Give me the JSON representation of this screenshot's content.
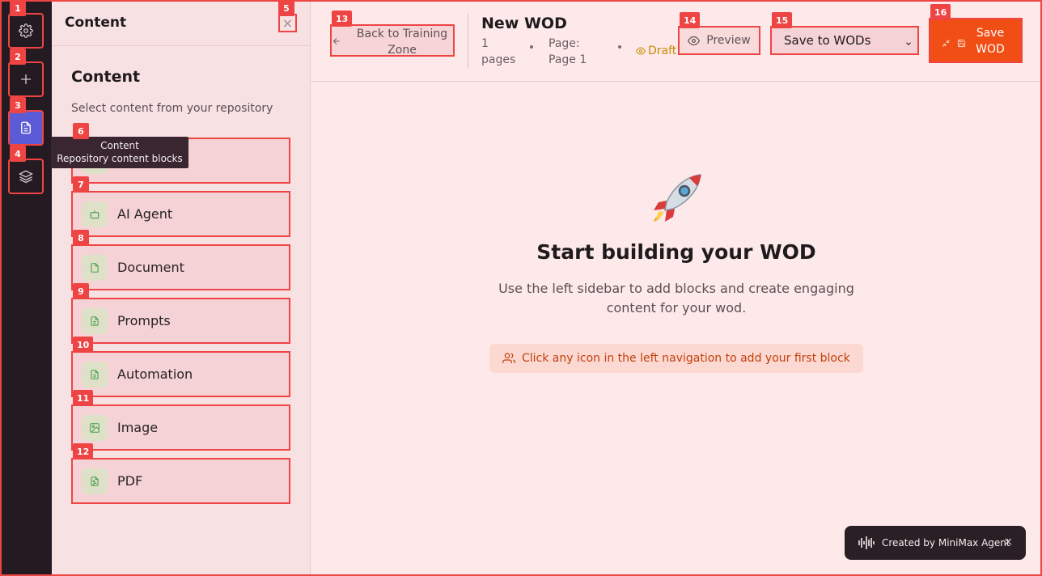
{
  "colors": {
    "accent": "#f04e15",
    "badge": "#ef4444",
    "rail": "#241a22",
    "active": "#5b5bd6",
    "draft": "#c88a00"
  },
  "badges": [
    "1",
    "2",
    "3",
    "4",
    "5",
    "6",
    "7",
    "8",
    "9",
    "10",
    "11",
    "12",
    "13",
    "14",
    "15",
    "16"
  ],
  "rail": {
    "items": [
      {
        "icon": "gear-icon"
      },
      {
        "icon": "plus-icon"
      },
      {
        "icon": "document-icon",
        "active": true
      },
      {
        "icon": "layers-icon"
      }
    ]
  },
  "tooltip": {
    "title": "Content",
    "subtitle": "Repository content blocks"
  },
  "panel": {
    "header_title": "Content",
    "close_icon": "×",
    "heading": "Content",
    "subtitle": "Select content from your repository",
    "items": [
      {
        "label": "",
        "icon": "document-icon"
      },
      {
        "label": "AI Agent",
        "icon": "bot-icon"
      },
      {
        "label": "Document",
        "icon": "file-icon"
      },
      {
        "label": "Prompts",
        "icon": "file-text-icon"
      },
      {
        "label": "Automation",
        "icon": "file-text-icon"
      },
      {
        "label": "Image",
        "icon": "image-icon"
      },
      {
        "label": "PDF",
        "icon": "file-image-icon"
      }
    ]
  },
  "header": {
    "back_label": "Back to Training Zone",
    "title": "New WOD",
    "pages_count": "1",
    "pages_word": "pages",
    "page_label": "Page:",
    "page_value": "Page 1",
    "status": "Draft",
    "preview_label": "Preview",
    "save_select_value": "Save to WODs",
    "save_button_label": "Save WOD"
  },
  "main": {
    "emoji": "🚀",
    "title": "Start building your WOD",
    "description": "Use the left sidebar to add blocks and create engaging content for your wod.",
    "hint": "Click any icon in the left navigation to add your first block"
  },
  "footer_badge": {
    "label": "Created by MiniMax Agent",
    "close": "×"
  }
}
